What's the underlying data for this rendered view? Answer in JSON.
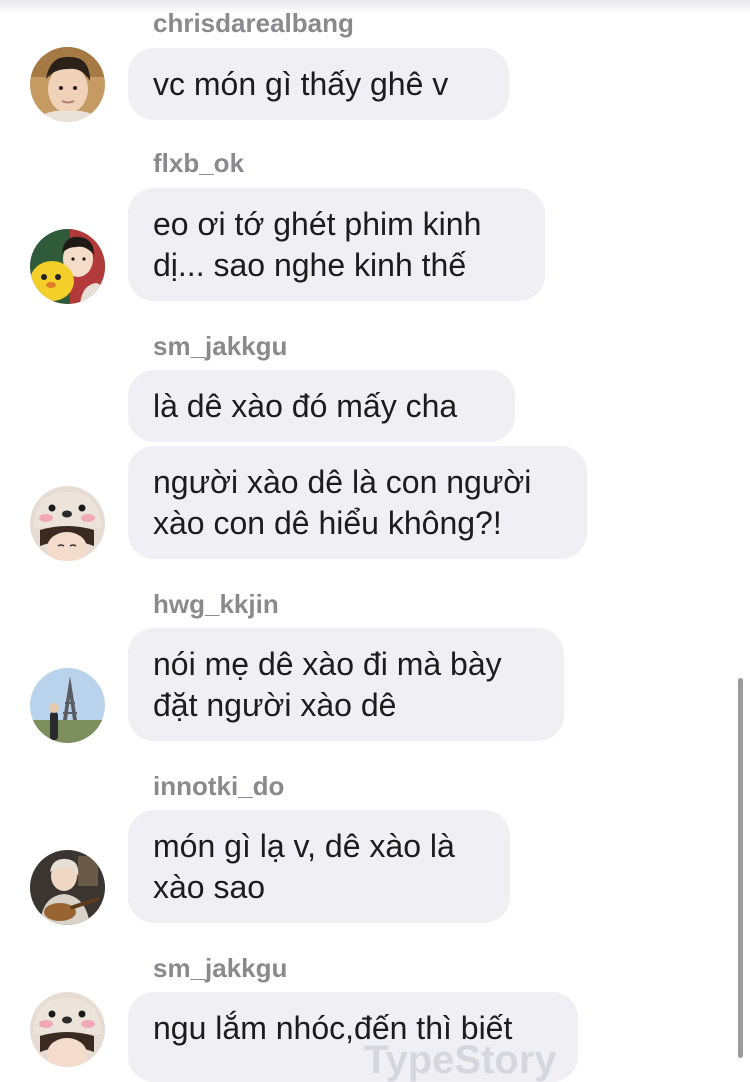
{
  "comments": [
    {
      "username": "chrisdarealbang",
      "text": "vc món gì thấy ghê v"
    },
    {
      "username": "flxb_ok",
      "text": "eo ơi tớ ghét phim kinh\ndị... sao nghe kinh thế"
    },
    {
      "username": "sm_jakkgu",
      "text": "là dê xào đó mấy cha"
    },
    {
      "username": "",
      "text": "người xào dê là con người\nxào con dê hiểu không?!"
    },
    {
      "username": "hwg_kkjin",
      "text": "nói mẹ dê xào đi mà bày\nđặt người xào dê"
    },
    {
      "username": "innotki_do",
      "text": "món gì lạ v, dê xào là\nxào sao"
    },
    {
      "username": "sm_jakkgu",
      "text": "ngu lắm nhóc,đến thì biết"
    }
  ],
  "avatars": [
    {
      "icon": "boy-portrait-avatar-icon"
    },
    {
      "icon": "boy-with-yellow-plush-avatar-icon"
    },
    {
      "icon": "bear-hat-avatar-icon"
    },
    {
      "icon": "eiffel-tower-photo-avatar-icon"
    },
    {
      "icon": "guitarist-avatar-icon"
    },
    {
      "icon": "bear-hat-avatar-icon"
    }
  ],
  "watermark": "TypeStory",
  "colors": {
    "bubble": "#efeff4",
    "username": "#8a8a8e",
    "text": "#1c1c1e"
  }
}
